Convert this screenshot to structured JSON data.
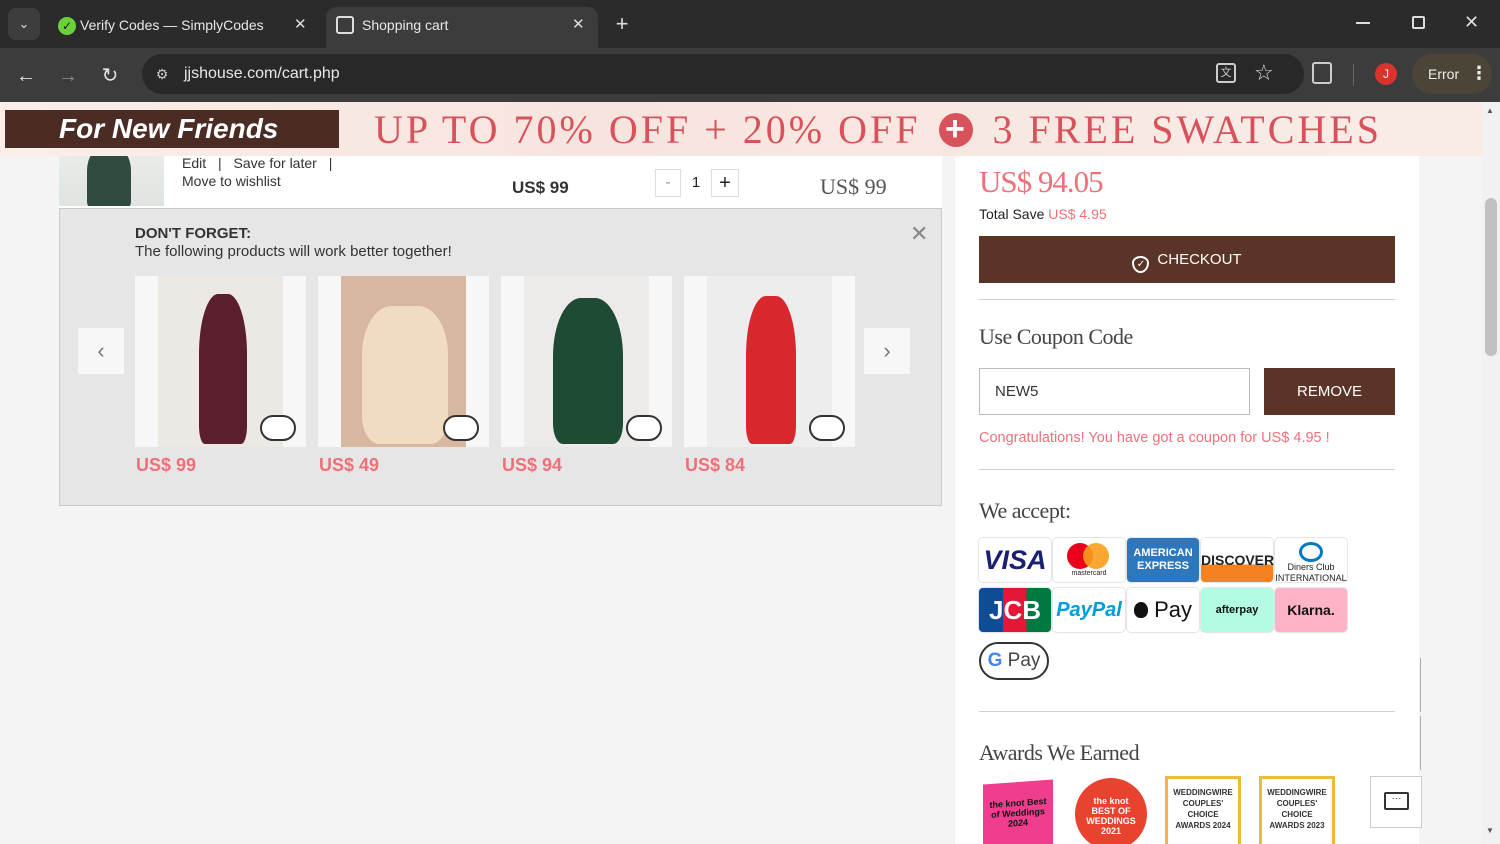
{
  "browser": {
    "tabs": [
      {
        "title": "Verify Codes — SimplyCodes",
        "active": false
      },
      {
        "title": "Shopping cart",
        "active": true
      }
    ],
    "url": "jjshouse.com/cart.php",
    "error_label": "Error",
    "profile_initial": "J"
  },
  "banner": {
    "ribbon": "For New Friends",
    "promo_left": "UP TO 70% OFF + 20% OFF",
    "promo_plus": "+",
    "promo_right": "3 FREE SWATCHES"
  },
  "cart_item": {
    "edit": "Edit",
    "save_for_later": "Save for later",
    "move_to_wishlist": "Move to wishlist",
    "unit_price": "US$ 99",
    "quantity": "1",
    "subtotal": "US$ 99"
  },
  "dont_forget": {
    "heading": "DON'T FORGET:",
    "subheading": "The following products will work better together!",
    "products": [
      {
        "price": "US$ 99",
        "color": "#5a1e2c"
      },
      {
        "price": "US$ 49",
        "color": "#e9c9a6"
      },
      {
        "price": "US$ 94",
        "color": "#1f4a34"
      },
      {
        "price": "US$ 84",
        "color": "#d8282e"
      }
    ]
  },
  "summary": {
    "total": "US$ 94.05",
    "total_save_label": "Total Save",
    "total_save_value": "US$ 4.95",
    "checkout_label": "CHECKOUT",
    "coupon_heading": "Use Coupon Code",
    "coupon_value": "NEW5",
    "remove_label": "REMOVE",
    "coupon_message": "Congratulations! You have got a coupon for US$ 4.95 !",
    "we_accept": "We accept:",
    "payment_methods": [
      "VISA",
      "mastercard",
      "AMERICAN EXPRESS",
      "DISCOVER",
      "Diners Club INTERNATIONAL",
      "JCB",
      "PayPal",
      "Pay",
      "afterpay",
      "Klarna.",
      "Pay"
    ],
    "awards_heading": "Awards We Earned",
    "awards": [
      {
        "text": "the knot Best of Weddings 2024"
      },
      {
        "text": "the knot BEST OF WEDDINGS 2021"
      },
      {
        "text": "WEDDINGWIRE COUPLES' CHOICE AWARDS 2024"
      },
      {
        "text": "WEDDINGWIRE COUPLES' CHOICE AWARDS 2023"
      }
    ]
  },
  "colors": {
    "brand_brown": "#5b3428",
    "accent_red": "#f0707a",
    "banner_red": "#d8525b"
  }
}
